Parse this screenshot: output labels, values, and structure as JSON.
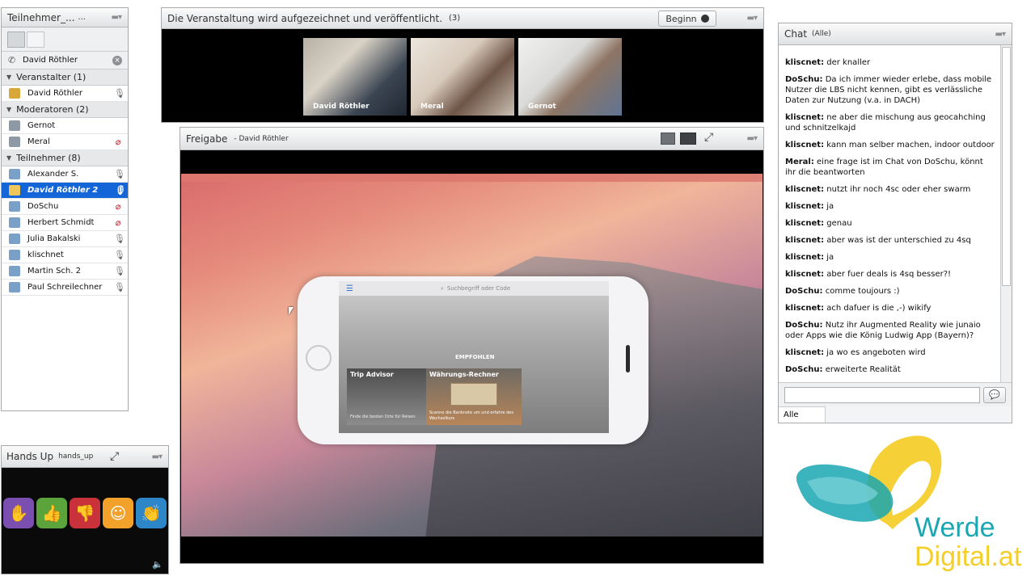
{
  "attendees_pod": {
    "title": "Teilnehmer_...",
    "title_more": "...",
    "menu_icon": "menu-icon",
    "search_name": "David Röthler",
    "groups": [
      {
        "label": "Veranstalter (1)",
        "members": [
          {
            "name": "David Röthler",
            "mic": "mic-active-icon"
          }
        ]
      },
      {
        "label": "Moderatoren (2)",
        "members": [
          {
            "name": "Gernot",
            "mic": ""
          },
          {
            "name": "Meral",
            "mic": "mic-muted-icon"
          }
        ]
      },
      {
        "label": "Teilnehmer (8)",
        "members": [
          {
            "name": "Alexander S.",
            "mic": "mic-icon"
          },
          {
            "name": "David Röthler 2",
            "mic": "mic-icon",
            "selected": true
          },
          {
            "name": "DoSchu",
            "mic": "mic-muted-icon"
          },
          {
            "name": "Herbert Schmidt",
            "mic": "mic-muted-icon"
          },
          {
            "name": "Julia Bakalski",
            "mic": "mic-icon"
          },
          {
            "name": "klischnet",
            "mic": "mic-icon"
          },
          {
            "name": "Martin Sch. 2",
            "mic": "mic-icon"
          },
          {
            "name": "Paul Schreilechner",
            "mic": "mic-icon"
          }
        ]
      }
    ]
  },
  "video_pod": {
    "title": "Die Veranstaltung wird aufgezeichnet und veröffentlicht.",
    "count": "(3)",
    "start_button": "Beginn",
    "videos": [
      {
        "name": "David Röthler"
      },
      {
        "name": "Meral"
      },
      {
        "name": "Gernot"
      }
    ]
  },
  "share_pod": {
    "title": "Freigabe",
    "presenter": "- David Röthler",
    "phone": {
      "search_placeholder": "Suchbegriff oder Code",
      "label_recommended": "EMPFOHLEN",
      "card1_title": "Trip Advisor",
      "card1_text": "Finde die besten Orte für Reisen",
      "card2_title": "Währungs-Rechner",
      "card2_text": "Scanne die Banknote um und erfahre des Wechselkurs"
    }
  },
  "chat_pod": {
    "title": "Chat",
    "scope": "(Alle)",
    "messages": [
      {
        "author": "kliscnet:",
        "text": "der knaller"
      },
      {
        "author": "DoSchu:",
        "text": "Da ich immer wieder erlebe, dass mobile Nutzer die LBS nicht kennen, gibt es verlässliche Daten zur Nutzung (v.a. in DACH)"
      },
      {
        "author": "kliscnet:",
        "text": "ne aber die mischung aus geocahching und schnitzelkajd"
      },
      {
        "author": "kliscnet:",
        "text": "kann man selber machen, indoor outdoor"
      },
      {
        "author": "Meral:",
        "text": "eine frage ist im Chat von DoSchu, könnt ihr die beantworten"
      },
      {
        "author": "kliscnet:",
        "text": "nutzt ihr noch 4sc oder eher swarm"
      },
      {
        "author": "kliscnet:",
        "text": "ja"
      },
      {
        "author": "kliscnet:",
        "text": "genau"
      },
      {
        "author": "kliscnet:",
        "text": "aber was ist der unterschied zu 4sq"
      },
      {
        "author": "kliscnet:",
        "text": "ja"
      },
      {
        "author": "kliscnet:",
        "text": "aber fuer deals is 4sq besser?!"
      },
      {
        "author": "DoSchu:",
        "text": "comme toujours :)"
      },
      {
        "author": "kliscnet:",
        "text": "ach dafuer is die ,-) wikify"
      },
      {
        "author": "DoSchu:",
        "text": "Nutz ihr Augmented Reality wie junaio oder Apps wie die König Ludwig App (Bayern)?"
      },
      {
        "author": "kliscnet:",
        "text": "ja wo es angeboten wird"
      },
      {
        "author": "DoSchu:",
        "text": "erweiterte Realität"
      }
    ],
    "input_value": "",
    "recipient": "Alle"
  },
  "hands_pod": {
    "title": "Hands Up",
    "subtitle": "hands_up",
    "buttons": [
      {
        "name": "raise-hand-icon",
        "color": "#7b4fb0"
      },
      {
        "name": "thumbs-up-icon",
        "color": "#5ba33b"
      },
      {
        "name": "thumbs-down-icon",
        "color": "#c9313b"
      },
      {
        "name": "smile-icon",
        "color": "#f2a12a"
      },
      {
        "name": "clap-icon",
        "color": "#2c86c8"
      }
    ]
  },
  "logo": {
    "line1": "Werde",
    "line2": "Digital.at",
    "color_teal": "#1aa7b2",
    "color_yellow": "#f4cf2c"
  }
}
